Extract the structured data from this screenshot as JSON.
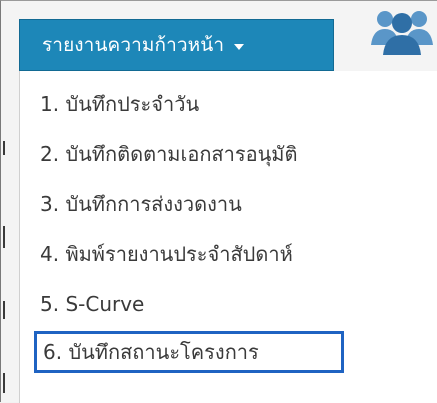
{
  "dropdown": {
    "label": "รายงานความก้าวหน้า"
  },
  "menu": {
    "items": [
      {
        "label": "1. บันทึกประจำวัน"
      },
      {
        "label": "2. บันทึกติดตามเอกสารอนุมัติ"
      },
      {
        "label": "3. บันทึกการส่งงวดงาน"
      },
      {
        "label": "4. พิมพ์รายงานประจำสัปดาห์"
      },
      {
        "label": "5. S-Curve"
      },
      {
        "label": "6. บันทึกสถานะโครงการ"
      }
    ],
    "highlighted_index": 5
  },
  "icons": {
    "users": "users-icon",
    "caret": "caret-down-icon"
  },
  "colors": {
    "button_bg": "#1d87b8",
    "highlight_border": "#1f63c2",
    "menu_text": "#3a3a3a"
  }
}
